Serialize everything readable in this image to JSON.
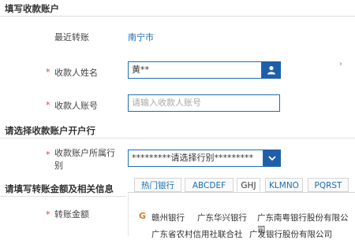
{
  "section_receiver": {
    "title": "填写收款账户"
  },
  "recent": {
    "label": "最近转账",
    "value": "南宁市"
  },
  "name_field": {
    "label": "收款人姓名",
    "value": "黄**"
  },
  "account_field": {
    "label": "收款人账号",
    "placeholder": "请输入收款人账号"
  },
  "section_bank": {
    "title": "请选择收款账户开户行"
  },
  "bank_field": {
    "label_line1": "收款账户所属行",
    "label_line2": "别",
    "value": "*********请选择行别*********"
  },
  "section_amount": {
    "title": "请填写转账金额及相关信息"
  },
  "amount_field": {
    "label": "转账金额"
  },
  "required_mark": "*",
  "tabs": [
    {
      "label": "热门银行",
      "active": false
    },
    {
      "label": "ABCDEF",
      "active": false
    },
    {
      "label": "GHJ",
      "active": true
    },
    {
      "label": "KLMNO",
      "active": false
    },
    {
      "label": "PQRST",
      "active": false
    }
  ],
  "bank_list": {
    "group_letter": "G",
    "row1": [
      "赣州银行",
      "广东华兴银行",
      "广东南粤银行股份有限公司"
    ],
    "row2": [
      "广东省农村信用社联合社",
      "广发银行股份有限公司"
    ]
  },
  "colors": {
    "accent": "#1a6fb5",
    "button": "#1f5fa8",
    "required": "#e03a3a",
    "letter": "#e07a2a"
  }
}
